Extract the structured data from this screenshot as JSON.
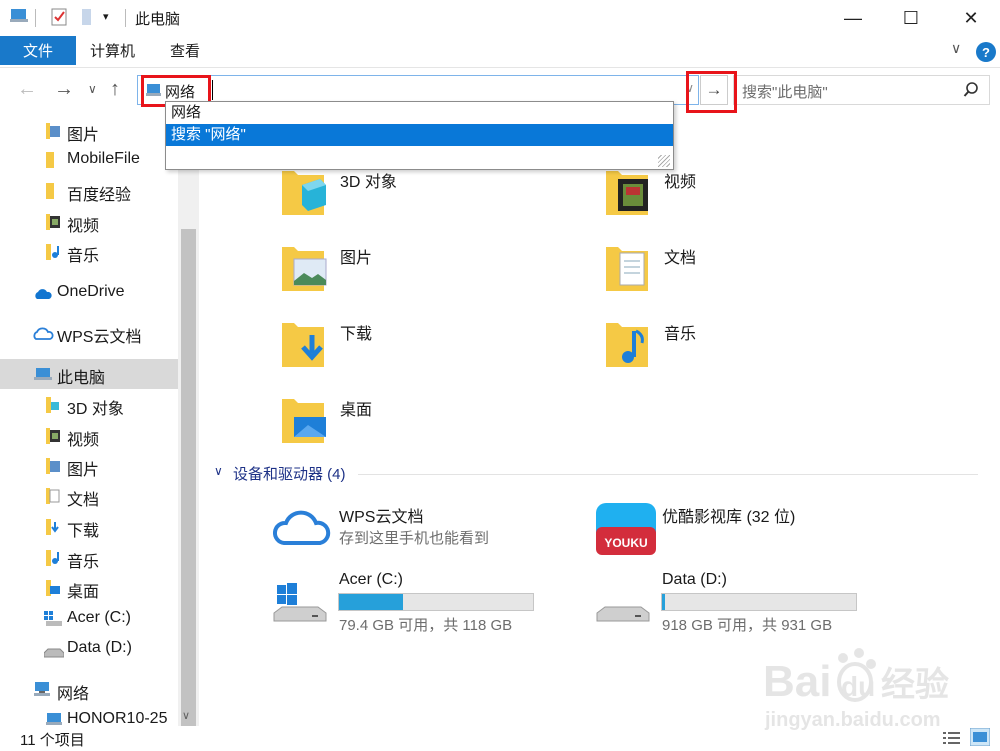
{
  "window": {
    "title": "此电脑",
    "minimize": "—",
    "maximize": "☐",
    "close": "✕"
  },
  "ribbon": {
    "tabs": [
      "文件",
      "计算机",
      "查看"
    ],
    "help": "?"
  },
  "nav": {
    "address_value": "网络",
    "search_placeholder": "搜索\"此电脑\""
  },
  "autocomplete": {
    "items": [
      "网络",
      "搜索 \"网络\""
    ],
    "selected_index": 1
  },
  "sidebar": {
    "items": [
      {
        "label": "图片",
        "icon": "pictures-folder-icon"
      },
      {
        "label": "MobileFile",
        "icon": "folder-icon"
      },
      {
        "label": "百度经验",
        "icon": "folder-icon"
      },
      {
        "label": "视频",
        "icon": "videos-folder-icon"
      },
      {
        "label": "音乐",
        "icon": "music-folder-icon"
      },
      {
        "label": "OneDrive",
        "icon": "onedrive-cloud-icon"
      },
      {
        "label": "WPS云文档",
        "icon": "wps-cloud-icon"
      },
      {
        "label": "此电脑",
        "icon": "this-pc-icon",
        "selected": true
      },
      {
        "label": "3D 对象",
        "icon": "3d-objects-icon"
      },
      {
        "label": "视频",
        "icon": "videos-folder-icon"
      },
      {
        "label": "图片",
        "icon": "pictures-folder-icon"
      },
      {
        "label": "文档",
        "icon": "documents-folder-icon"
      },
      {
        "label": "下载",
        "icon": "downloads-folder-icon"
      },
      {
        "label": "音乐",
        "icon": "music-folder-icon"
      },
      {
        "label": "桌面",
        "icon": "desktop-folder-icon"
      },
      {
        "label": "Acer (C:)",
        "icon": "windows-drive-icon"
      },
      {
        "label": "Data (D:)",
        "icon": "drive-icon"
      },
      {
        "label": "网络",
        "icon": "network-icon"
      },
      {
        "label": "HONOR10-25",
        "icon": "computer-icon"
      }
    ]
  },
  "folders": [
    {
      "label": "3D 对象"
    },
    {
      "label": "视频"
    },
    {
      "label": "图片"
    },
    {
      "label": "文档"
    },
    {
      "label": "下载"
    },
    {
      "label": "音乐"
    },
    {
      "label": "桌面"
    }
  ],
  "devices": {
    "header": "设备和驱动器 (4)",
    "items": [
      {
        "name": "WPS云文档",
        "detail": "存到这里手机也能看到"
      },
      {
        "name": "优酷影视库 (32 位)",
        "detail": ""
      },
      {
        "name": "Acer (C:)",
        "detail": "79.4 GB 可用，共 118 GB",
        "used_fraction": 0.33
      },
      {
        "name": "Data (D:)",
        "detail": "918 GB 可用，共 931 GB",
        "used_fraction": 0.014
      }
    ]
  },
  "youku_text": "YOUKU",
  "status": {
    "count": "11 个项目"
  },
  "watermark": {
    "line1": "Bai",
    "line2": "du",
    "line3": "经验",
    "url": "jingyan.baidu.com"
  },
  "colors": {
    "accent": "#1979ca",
    "selection": "#0978d8",
    "highlight_box": "#e8141a",
    "drive_bar": "#26a0da",
    "section_header": "#1e3287"
  }
}
